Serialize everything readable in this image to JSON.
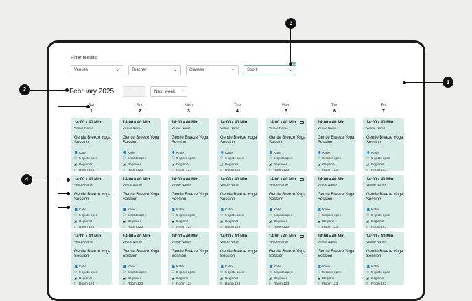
{
  "filters": {
    "title": "Filter results",
    "items": [
      {
        "label": "Venues",
        "active": false
      },
      {
        "label": "Teacher",
        "active": false
      },
      {
        "label": "Classes",
        "active": false
      },
      {
        "label": "Sport",
        "active": true
      }
    ]
  },
  "calendar": {
    "month": "February 2025",
    "next_label": "Next week",
    "days": [
      {
        "dow": "Sat",
        "num": "1"
      },
      {
        "dow": "Sun",
        "num": "2"
      },
      {
        "dow": "Mon",
        "num": "3"
      },
      {
        "dow": "Tue",
        "num": "4"
      },
      {
        "dow": "Wed",
        "num": "5"
      },
      {
        "dow": "Thu",
        "num": "6"
      },
      {
        "dow": "Fri",
        "num": "7"
      }
    ],
    "session": {
      "time": "14:00 • 40 Min",
      "venue": "Venue Name",
      "class_name": "Gentle Breeze Yoga Session",
      "teacher": "Katie",
      "spots": "5 spots open",
      "level": "Beginner",
      "room": "Room 123"
    }
  },
  "callouts": [
    "1",
    "2",
    "3",
    "4"
  ],
  "colors": {
    "card": "#d4ebe6",
    "accent": "#5fb8aa",
    "frame": "#1c1c1c"
  }
}
